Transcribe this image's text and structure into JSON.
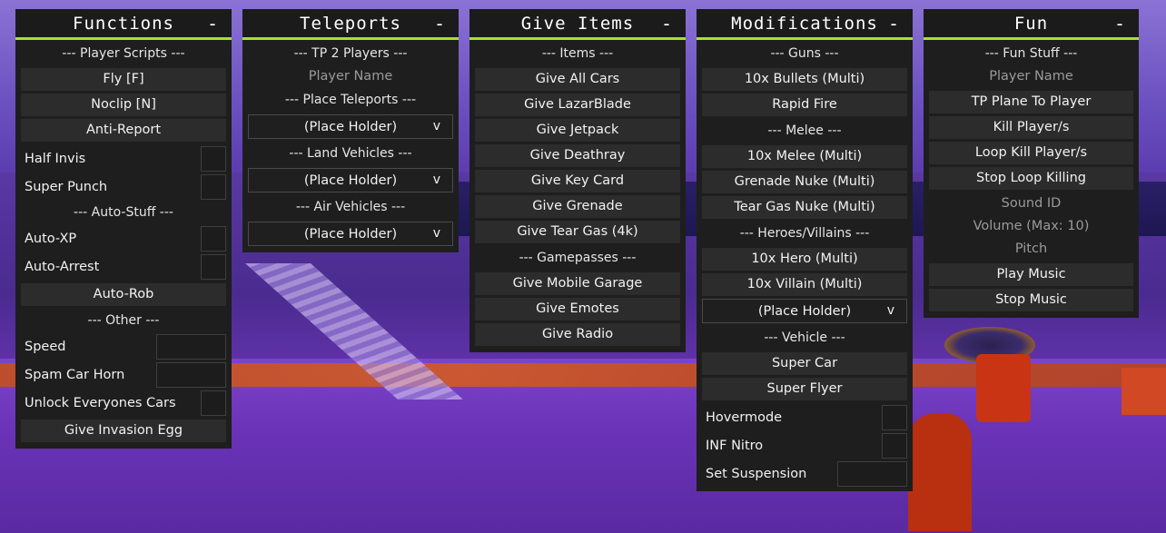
{
  "functions": {
    "title": "Functions",
    "minimize": "-",
    "player_scripts": "--- Player Scripts ---",
    "fly": "Fly [F]",
    "noclip": "Noclip [N]",
    "anti_report": "Anti-Report",
    "half_invis": "Half Invis",
    "super_punch": "Super Punch",
    "auto_stuff": "--- Auto-Stuff ---",
    "auto_xp": "Auto-XP",
    "auto_arrest": "Auto-Arrest",
    "auto_rob": "Auto-Rob",
    "other": "--- Other ---",
    "speed": "Speed",
    "spam_car_horn": "Spam Car Horn",
    "unlock_cars": "Unlock Everyones Cars",
    "give_invasion_egg": "Give Invasion Egg"
  },
  "teleports": {
    "title": "Teleports",
    "minimize": "-",
    "tp2players": "--- TP 2 Players ---",
    "player_name": "Player Name",
    "place_teleports": "--- Place Teleports ---",
    "place_holder_1": "(Place Holder)",
    "land_vehicles": "--- Land Vehicles ---",
    "place_holder_2": "(Place Holder)",
    "air_vehicles": "--- Air Vehicles ---",
    "place_holder_3": "(Place Holder)",
    "arrow": "v"
  },
  "give_items": {
    "title": "Give Items",
    "minimize": "-",
    "items": "--- Items ---",
    "all_cars": "Give All Cars",
    "lazarblade": "Give LazarBlade",
    "jetpack": "Give Jetpack",
    "deathray": "Give Deathray",
    "key_card": "Give Key Card",
    "grenade": "Give Grenade",
    "tear_gas": "Give Tear Gas (4k)",
    "gamepasses": "--- Gamepasses ---",
    "mobile_garage": "Give Mobile Garage",
    "emotes": "Give Emotes",
    "radio": "Give Radio"
  },
  "modifications": {
    "title": "Modifications",
    "minimize": "-",
    "guns": "--- Guns ---",
    "bullets": "10x Bullets (Multi)",
    "rapid_fire": "Rapid Fire",
    "melee": "--- Melee ---",
    "melee_multi": "10x Melee (Multi)",
    "grenade_nuke": "Grenade Nuke (Multi)",
    "tear_gas_nuke": "Tear Gas Nuke (Multi)",
    "heroes_villains": "--- Heroes/Villains ---",
    "hero": "10x Hero (Multi)",
    "villain": "10x Villain (Multi)",
    "place_holder": "(Place Holder)",
    "arrow": "v",
    "vehicle": "--- Vehicle ---",
    "super_car": "Super Car",
    "super_flyer": "Super Flyer",
    "hovermode": "Hovermode",
    "inf_nitro": "INF Nitro",
    "set_suspension": "Set Suspension"
  },
  "fun": {
    "title": "Fun",
    "minimize": "-",
    "fun_stuff": "--- Fun Stuff ---",
    "player_name": "Player Name",
    "tp_plane": "TP Plane To Player",
    "kill_players": "Kill Player/s",
    "loop_kill": "Loop Kill Player/s",
    "stop_loop": "Stop Loop Killing",
    "sound_id": "Sound ID",
    "volume": "Volume (Max: 10)",
    "pitch": "Pitch",
    "play_music": "Play Music",
    "stop_music": "Stop Music"
  },
  "colors": {
    "accent": "#a6e22e",
    "panel_bg": "#1e1e1e",
    "button_bg": "#2c2c2c"
  }
}
